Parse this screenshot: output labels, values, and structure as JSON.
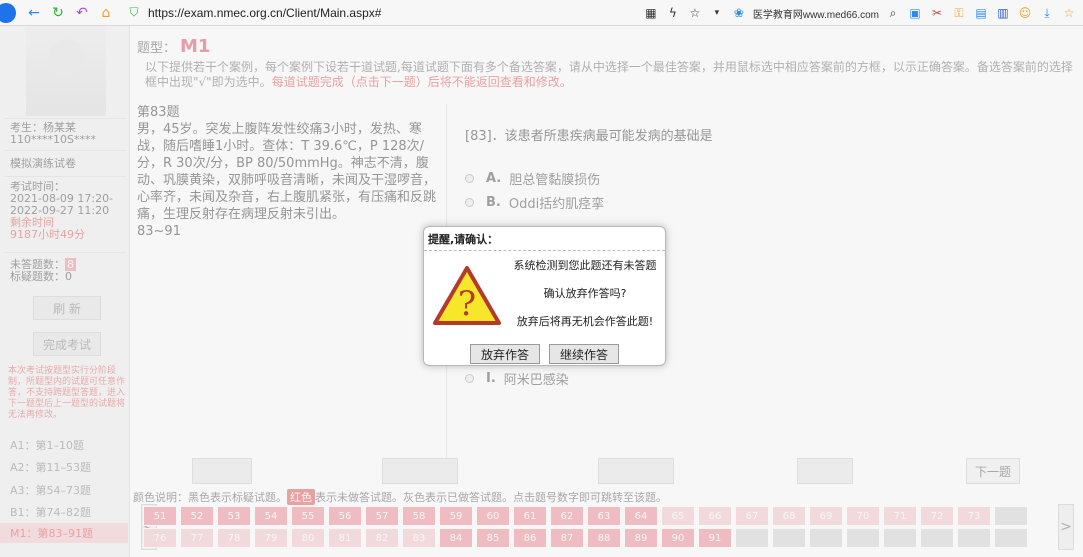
{
  "browser": {
    "url": "https://exam.nmec.org.cn/Client/Main.aspx#",
    "ext_site": "医学教育网www.med66.com"
  },
  "sidebar": {
    "examinee_label": "考生：杨某某",
    "examinee_id": "110****10S****",
    "exam_name": "模拟演练试卷",
    "time_label": "考试时间：",
    "time_start": "2021-08-09 17:20-",
    "time_end": "2022-09-27 11:20",
    "remaining_label": "剩余时间",
    "remaining_value": "9187小时49分",
    "unanswered_label": "未答题数：",
    "unanswered_value": "8",
    "marked_label": "标疑题数：",
    "marked_value": "0",
    "refresh_btn": "刷 新",
    "finish_btn": "完成考试",
    "note": "本次考试按题型实行分阶段制，所题型内的试题可任意作答，不支持跨题型答题，进入下一题型后上一题型的试题将无法再修改。",
    "sections": [
      "A1：第1–10题",
      "A2：第11–53题",
      "A3：第54–73题",
      "B1：第74–82题",
      "M1：第83–91题"
    ]
  },
  "main": {
    "qtype_label": "题型：",
    "qtype_value": "M1",
    "instruction": "以下提供若干个案例，每个案例下设若干道试题,每道试题下面有多个备选答案，请从中选择一个最佳答案，并用鼠标选中相应答案前的方框，以示正确答案。备选答案前的选择框中出现\"√\"即为选中。",
    "instruction_red": "每道试题完成（点击下一题）后将不能返回查看和修改。",
    "case_title": "第83题",
    "case_text": "男，45岁。突发上腹阵发性绞痛3小时，发热、寒战，随后嗜睡1小时。查体：T 39.6℃，P 128次/分，R 30次/分，BP 80/50mmHg。神志不清，腹动、巩膜黄染，双肺呼吸音清晰，未闻及干湿啰音，心率齐，未闻及杂音，右上腹肌紧张，有压痛和反跳痛，生理反射存在病理反射未引出。",
    "case_range": "83~91",
    "question": "[83]．该患者所患疾病最可能发病的基础是",
    "options": [
      {
        "letter": "A.",
        "text": "胆总管黏膜损伤"
      },
      {
        "letter": "B.",
        "text": "Oddi括约肌痉挛"
      },
      {
        "letter": "I.",
        "text": "阿米巴感染"
      }
    ],
    "next_btn": "下一题",
    "legend_a": "颜色说明：黑色表示标疑试题。",
    "legend_badge": "红色",
    "legend_b": "表示未做答试题。灰色表示已做答试题。点击题号数字即可跳转至该题。",
    "row1": [
      "51",
      "52",
      "53",
      "54",
      "55",
      "56",
      "57",
      "58",
      "59",
      "60",
      "61",
      "62",
      "63",
      "64",
      "65",
      "66",
      "67",
      "68",
      "69",
      "70",
      "71",
      "72",
      "73",
      ""
    ],
    "row2": [
      "76",
      "77",
      "78",
      "79",
      "80",
      "81",
      "82",
      "83",
      "84",
      "85",
      "86",
      "87",
      "88",
      "89",
      "90",
      "91",
      "",
      "",
      "",
      "",
      "",
      "",
      "",
      ""
    ]
  },
  "dialog": {
    "title": "提醒,请确认：",
    "msg1": "系统检测到您此题还有未答题",
    "msg2": "确认放弃作答吗?",
    "msg3": "放弃后将再无机会作答此题!",
    "btn_abandon": "放弃作答",
    "btn_continue": "继续作答"
  }
}
